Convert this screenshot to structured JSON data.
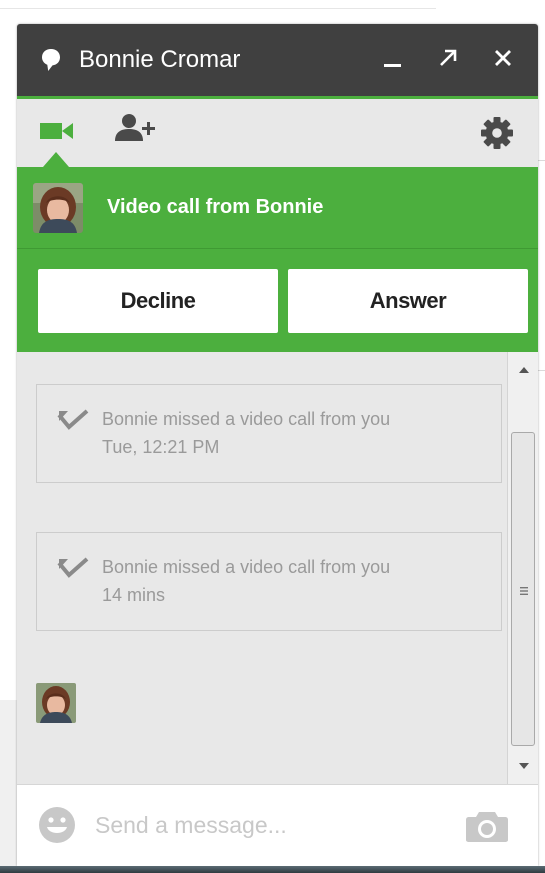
{
  "window": {
    "contact_name": "Bonnie Cromar"
  },
  "titlebar": {
    "icons": [
      "chat-bubble-icon",
      "minimize-icon",
      "pop-out-icon",
      "close-icon"
    ]
  },
  "toolbar": {
    "icons": [
      "video-camera-icon",
      "add-person-icon",
      "gear-icon"
    ]
  },
  "call": {
    "title": "Video call from Bonnie",
    "decline_label": "Decline",
    "answer_label": "Answer"
  },
  "messages": [
    {
      "text": "Bonnie missed a video call from you",
      "time": "Tue, 12:21 PM"
    },
    {
      "text": "Bonnie missed a video call from you",
      "time": "14 mins"
    }
  ],
  "composer": {
    "value": "",
    "placeholder": "Send a message..."
  },
  "colors": {
    "accent": "#4caf3e",
    "titlebar": "#404040",
    "panel": "#e8e8e8"
  }
}
